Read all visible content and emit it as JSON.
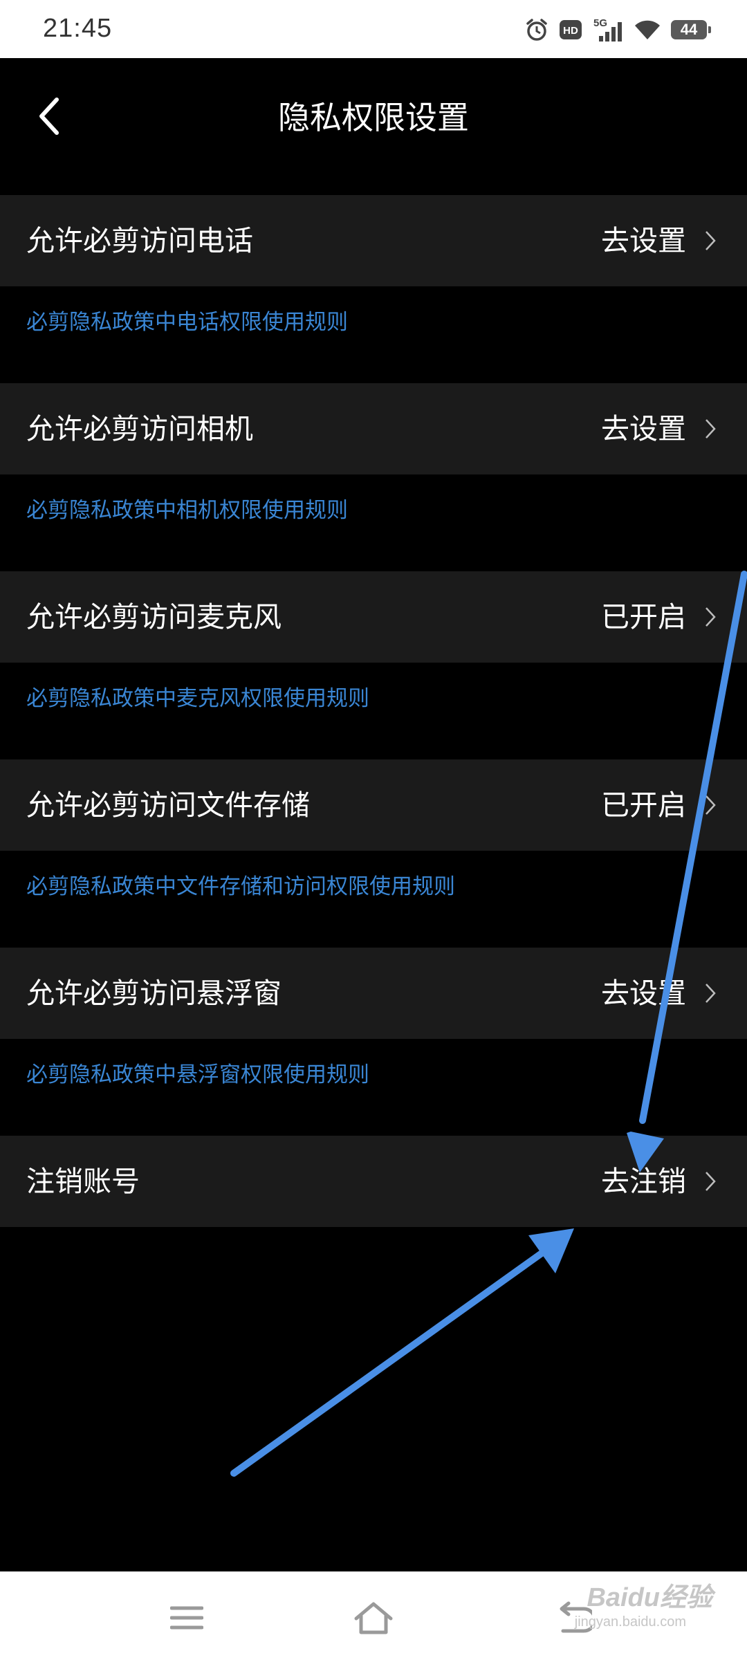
{
  "status_bar": {
    "time": "21:45",
    "network": "5G",
    "hd_badge": "HD",
    "battery_level": "44",
    "icons": [
      "alarm-icon",
      "hd-icon",
      "signal-5g-icon",
      "wifi-icon",
      "battery-icon"
    ]
  },
  "header": {
    "title": "隐私权限设置",
    "back_icon": "chevron-left-icon"
  },
  "permissions": [
    {
      "label": "允许必剪访问电话",
      "action": "去设置",
      "policy_link": "必剪隐私政策中电话权限使用规则"
    },
    {
      "label": "允许必剪访问相机",
      "action": "去设置",
      "policy_link": "必剪隐私政策中相机权限使用规则"
    },
    {
      "label": "允许必剪访问麦克风",
      "action": "已开启",
      "policy_link": "必剪隐私政策中麦克风权限使用规则"
    },
    {
      "label": "允许必剪访问文件存储",
      "action": "已开启",
      "policy_link": "必剪隐私政策中文件存储和访问权限使用规则"
    },
    {
      "label": "允许必剪访问悬浮窗",
      "action": "去设置",
      "policy_link": "必剪隐私政策中悬浮窗权限使用规则"
    }
  ],
  "account": {
    "label": "注销账号",
    "action": "去注销"
  },
  "watermark": {
    "text": "Baidu经验",
    "sub": "jingyan.baidu.com"
  },
  "colors": {
    "background": "#000000",
    "row_background": "#1b1b1b",
    "link": "#3a86d4",
    "annotation_arrow": "#4a8fe6"
  }
}
